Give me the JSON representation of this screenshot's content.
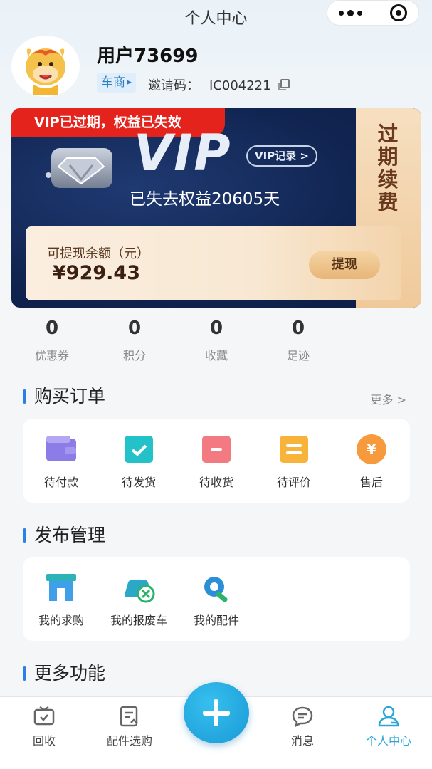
{
  "header": {
    "title": "个人中心"
  },
  "profile": {
    "username": "用户73699",
    "role_tag": "车商",
    "invite_label": "邀请码：",
    "invite_code": "IC004221"
  },
  "vip": {
    "status_banner": "VIP已过期，权益已失效",
    "logo_text": "VIP",
    "record_button": "VIP记录 >",
    "lost_text": "已失去权益20605天",
    "renew_text": "过期续费",
    "balance_label": "可提现余额（元）",
    "balance_amount": "¥929.43",
    "withdraw_button": "提现"
  },
  "stats": [
    {
      "value": "0",
      "label": "优惠券"
    },
    {
      "value": "0",
      "label": "积分"
    },
    {
      "value": "0",
      "label": "收藏"
    },
    {
      "value": "0",
      "label": "足迹"
    }
  ],
  "orders": {
    "title": "购买订单",
    "more": "更多 >",
    "items": [
      {
        "label": "待付款",
        "icon": "wallet-icon"
      },
      {
        "label": "待发货",
        "icon": "box-check-icon"
      },
      {
        "label": "待收货",
        "icon": "package-icon"
      },
      {
        "label": "待评价",
        "icon": "review-icon"
      },
      {
        "label": "售后",
        "icon": "yuan-coin-icon"
      }
    ]
  },
  "publish": {
    "title": "发布管理",
    "items": [
      {
        "label": "我的求购",
        "icon": "store-icon"
      },
      {
        "label": "我的报废车",
        "icon": "scrap-car-icon"
      },
      {
        "label": "我的配件",
        "icon": "gear-wrench-icon"
      }
    ]
  },
  "more_functions": {
    "title": "更多功能"
  },
  "tabbar": [
    {
      "label": "回收",
      "icon": "tv-recycle-icon",
      "active": false
    },
    {
      "label": "配件选购",
      "icon": "list-doc-icon",
      "active": false
    },
    {
      "label": "消息",
      "icon": "message-icon",
      "active": false
    },
    {
      "label": "个人中心",
      "icon": "user-icon",
      "active": true
    }
  ],
  "colors": {
    "accent": "#2a7fe8",
    "active_tab": "#2aa6d9",
    "vip_red": "#e4231c",
    "vip_navy": "#112552"
  }
}
